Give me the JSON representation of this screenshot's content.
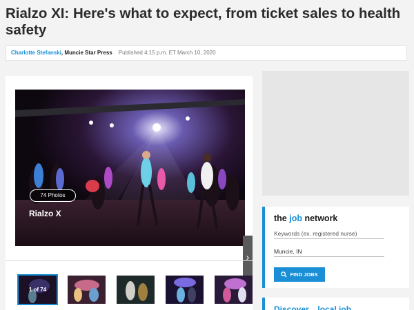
{
  "article": {
    "headline": "Rialzo XI: Here's what to expect, from ticket sales to health safety",
    "author": "Charlotte Stefanski",
    "organization": "Muncie Star Press",
    "published": "Published 4:15 p.m. ET March 10, 2020"
  },
  "gallery": {
    "photo_count": "74 Photos",
    "title": "Rialzo X",
    "next_icon": "chevron-right-icon",
    "thumbnails": [
      {
        "label": "1 of 74",
        "active": true
      },
      {
        "label": "",
        "active": false
      },
      {
        "label": "",
        "active": false
      },
      {
        "label": "",
        "active": false
      },
      {
        "label": "",
        "active": false
      }
    ]
  },
  "job_widget": {
    "brand_pre": "the ",
    "brand_accent": "job",
    "brand_post": " network",
    "keywords_placeholder": "Keywords (ex. registered nurse)",
    "location_value": "Muncie, IN",
    "button_label": "FIND JOBS",
    "button_icon": "search-icon"
  },
  "promo": {
    "text": "Discover... local job..."
  },
  "colors": {
    "accent": "#1a8fd6",
    "headline": "#2b2b2b",
    "background": "#f3f3f3"
  }
}
